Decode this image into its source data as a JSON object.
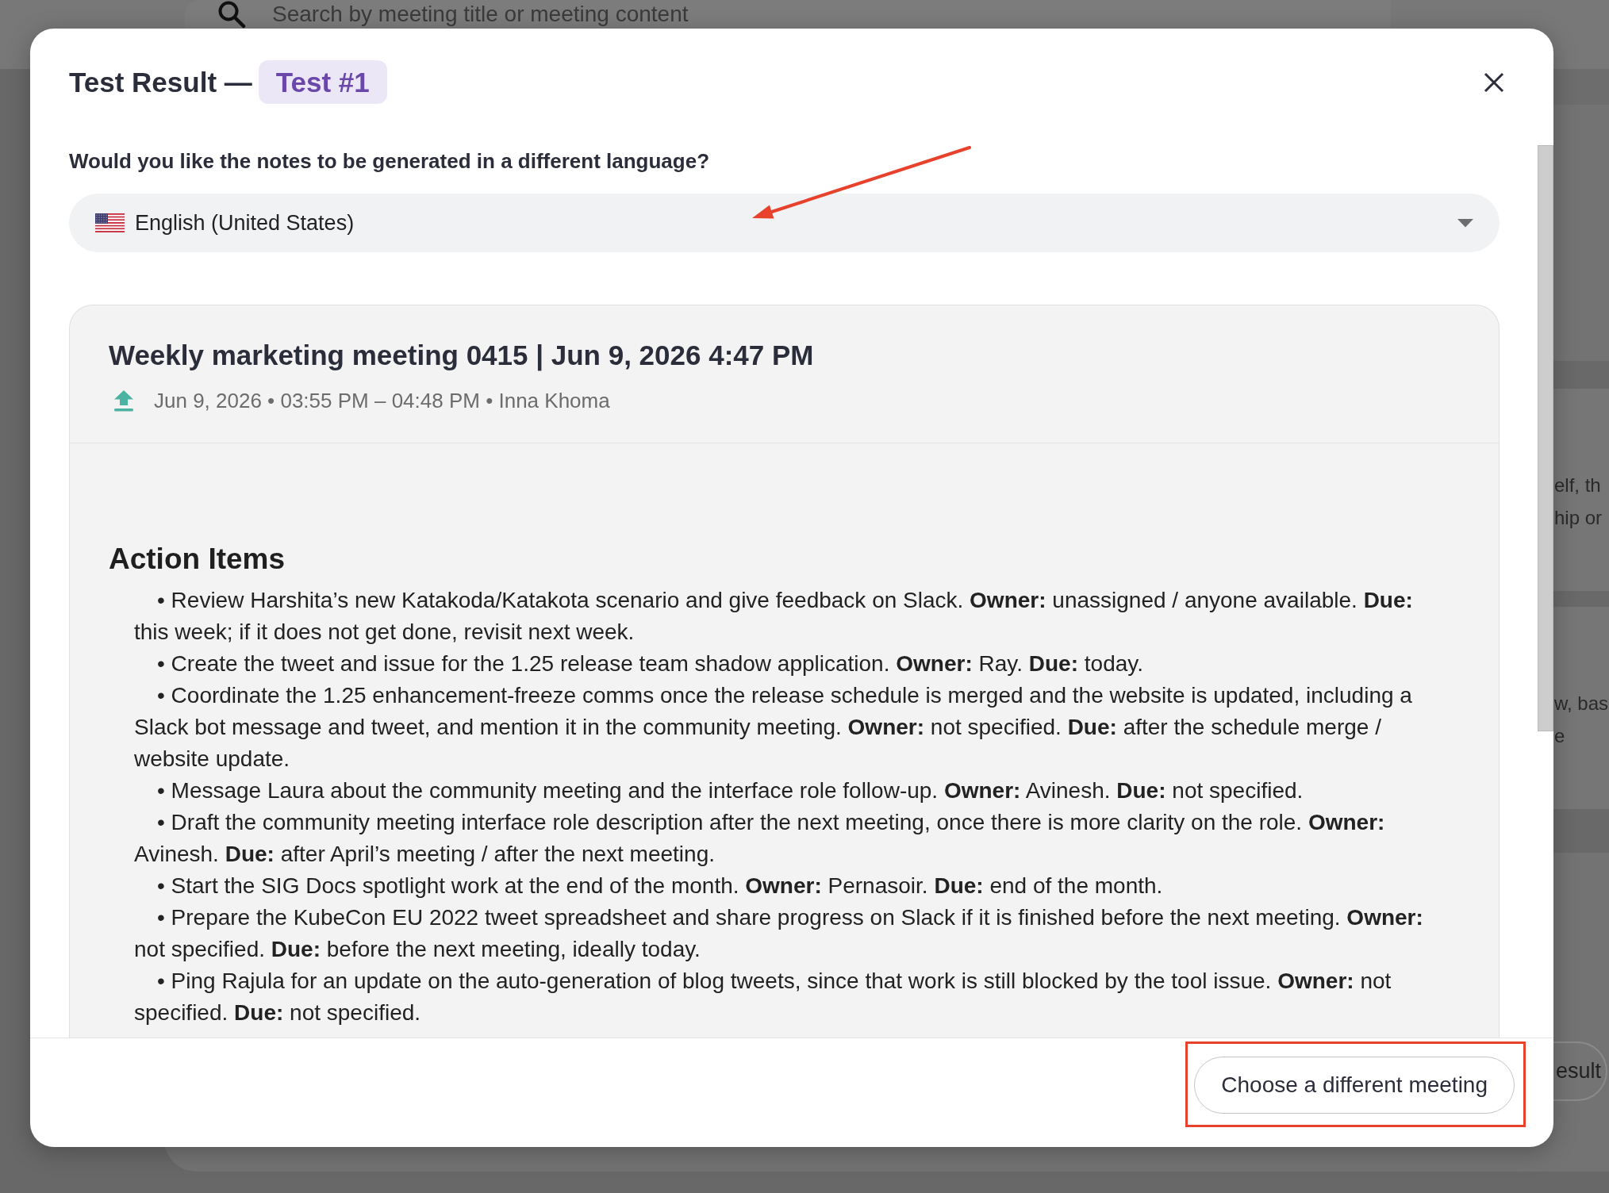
{
  "background": {
    "search": {
      "placeholder": "Search by meeting title or meeting content"
    },
    "cards": [
      {
        "lines": [
          "elf, th",
          "hip or"
        ]
      },
      {
        "lines": [
          "w, bas",
          "e"
        ]
      }
    ],
    "button": "esult"
  },
  "dialog": {
    "title": "Test Result —",
    "badge": "Test #1",
    "question": "Would you like the notes to be generated in a different language?",
    "language_select": {
      "value": "English (United States)",
      "arrow_annotation": true
    },
    "meeting": {
      "title": "Weekly marketing meeting 0415 | Jun 9, 2026 4:47 PM",
      "details": "Jun 9, 2026 • 03:55 PM – 04:48 PM • Inna Khoma",
      "section_heading": "Action Items",
      "action_items": [
        "• Review Harshita’s new Katakoda/Katakota scenario and give feedback on Slack. **Owner:** unassigned / anyone available. **Due:** this week; if it does not get done, revisit next week.",
        "• Create the tweet and issue for the 1.25 release team shadow application. **Owner:** Ray. **Due:** today.",
        "• Coordinate the 1.25 enhancement-freeze comms once the release schedule is merged and the website is updated, including a Slack bot message and tweet, and mention it in the community meeting. **Owner:** not specified. **Due:** after the schedule merge / website update.",
        "• Message Laura about the community meeting and the interface role follow-up. **Owner:** Avinesh. **Due:** not specified.",
        "• Draft the community meeting interface role description after the next meeting, once there is more clarity on the role. **Owner:** Avinesh. **Due:** after April’s meeting / after the next meeting.",
        "• Start the SIG Docs spotlight work at the end of the month. **Owner:** Pernasoir. **Due:** end of the month.",
        "• Prepare the KubeCon EU 2022 tweet spreadsheet and share progress on Slack if it is finished before the next meeting. **Owner:** not specified. **Due:** before the next meeting, ideally today.",
        "• Ping Rajula for an update on the auto-generation of blog tweets, since that work is still blocked by the tool issue. **Owner:** not specified. **Due:** not specified."
      ]
    },
    "footer_button": {
      "label": "Choose a different meeting",
      "highlighted": true
    }
  }
}
